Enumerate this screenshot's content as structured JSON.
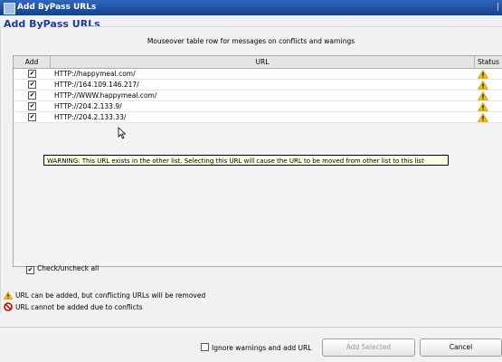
{
  "window": {
    "title": "Add ByPass URLs",
    "right_mark": "|"
  },
  "group": {
    "title": "Add ByPass URLs"
  },
  "hint": "Mouseover table row for messages on conflicts and warnings",
  "table": {
    "columns": {
      "add": "Add",
      "url": "URL",
      "status": "Status"
    },
    "rows": [
      {
        "checked": true,
        "url": "HTTP://happymeal.com/",
        "status": "warning-icon"
      },
      {
        "checked": true,
        "url": "HTTP://164.109.146.217/",
        "status": "warning-icon"
      },
      {
        "checked": true,
        "url": "HTTP://WWW.happymeal.com/",
        "status": "warning-icon"
      },
      {
        "checked": true,
        "url": "HTTP://204.2.133.9/",
        "status": "warning-icon"
      },
      {
        "checked": true,
        "url": "HTTP://204.2.133.33/",
        "status": "warning-icon"
      }
    ]
  },
  "tooltip": "WARNING: This URL exists in the other list. Selecting this URL will cause the URL to be moved from other list to this list",
  "check_all": {
    "checked": true,
    "label": "Check/uncheck all"
  },
  "legend": {
    "warning": "URL can be added, but conflicting URLs will be removed",
    "error": "URL cannot be added due to conflicts"
  },
  "footer": {
    "ignore_label": "Ignore warnings and add URL",
    "ignore_checked": false,
    "add_selected": "Add Selected",
    "cancel": "Cancel"
  },
  "colors": {
    "title_text": "#1e39a6",
    "warning": "#f2c200",
    "error": "#d40000",
    "titlebar": "#2f66b9"
  }
}
